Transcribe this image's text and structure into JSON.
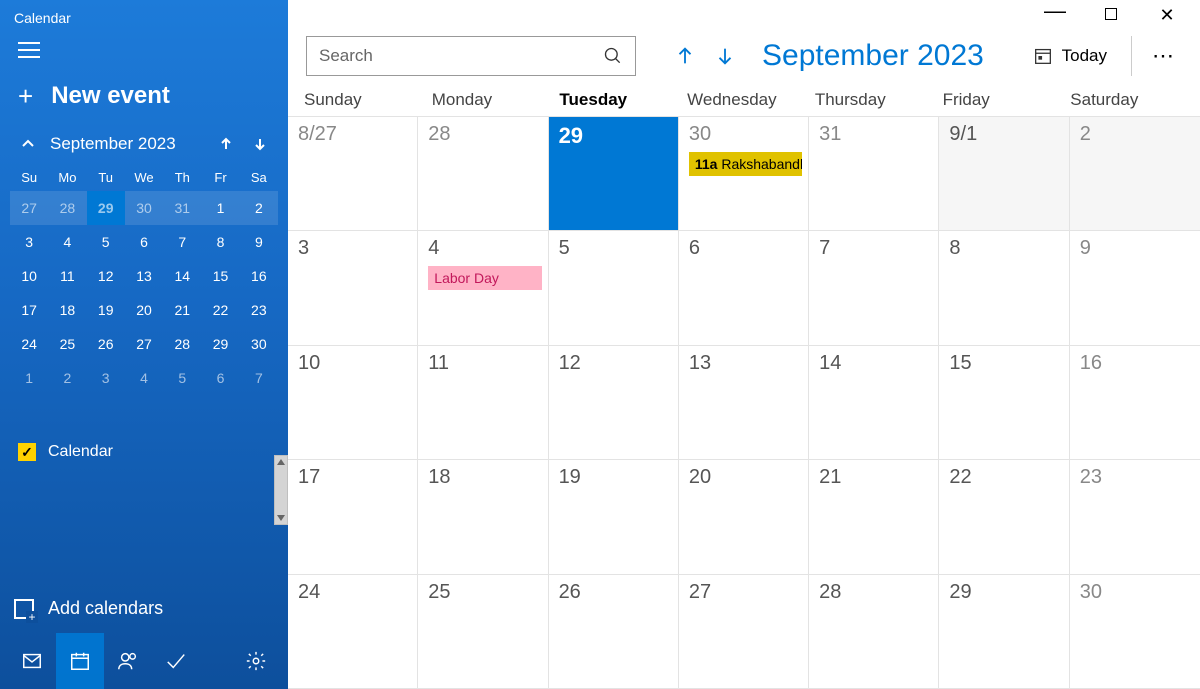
{
  "app": {
    "title": "Calendar"
  },
  "sidebar": {
    "new_event": "New event",
    "calendar_checkbox_label": "Calendar",
    "add_calendars": "Add calendars"
  },
  "mini_cal": {
    "month_label": "September 2023",
    "dow": [
      "Su",
      "Mo",
      "Tu",
      "We",
      "Th",
      "Fr",
      "Sa"
    ],
    "days": [
      {
        "n": "27",
        "out": true
      },
      {
        "n": "28",
        "out": true
      },
      {
        "n": "29",
        "sel": true,
        "out": true
      },
      {
        "n": "30",
        "out": true
      },
      {
        "n": "31",
        "out": true
      },
      {
        "n": "1"
      },
      {
        "n": "2"
      },
      {
        "n": "3"
      },
      {
        "n": "4"
      },
      {
        "n": "5"
      },
      {
        "n": "6"
      },
      {
        "n": "7"
      },
      {
        "n": "8"
      },
      {
        "n": "9"
      },
      {
        "n": "10"
      },
      {
        "n": "11"
      },
      {
        "n": "12"
      },
      {
        "n": "13"
      },
      {
        "n": "14"
      },
      {
        "n": "15"
      },
      {
        "n": "16"
      },
      {
        "n": "17"
      },
      {
        "n": "18"
      },
      {
        "n": "19"
      },
      {
        "n": "20"
      },
      {
        "n": "21"
      },
      {
        "n": "22"
      },
      {
        "n": "23"
      },
      {
        "n": "24"
      },
      {
        "n": "25"
      },
      {
        "n": "26"
      },
      {
        "n": "27"
      },
      {
        "n": "28"
      },
      {
        "n": "29"
      },
      {
        "n": "30"
      },
      {
        "n": "1",
        "out": true
      },
      {
        "n": "2",
        "out": true
      },
      {
        "n": "3",
        "out": true
      },
      {
        "n": "4",
        "out": true
      },
      {
        "n": "5",
        "out": true
      },
      {
        "n": "6",
        "out": true
      },
      {
        "n": "7",
        "out": true
      }
    ]
  },
  "toolbar": {
    "search_placeholder": "Search",
    "month_label": "September 2023",
    "today_label": "Today"
  },
  "dow_full": [
    "Sunday",
    "Monday",
    "Tuesday",
    "Wednesday",
    "Thursday",
    "Friday",
    "Saturday"
  ],
  "today_index": 2,
  "month_grid": [
    {
      "label": "8/27",
      "classes": "out"
    },
    {
      "label": "28",
      "classes": "out"
    },
    {
      "label": "29",
      "classes": "today"
    },
    {
      "label": "30",
      "classes": "out",
      "event": {
        "style": "yellow",
        "time": "11a",
        "title": "Rakshabandhan"
      }
    },
    {
      "label": "31",
      "classes": "out"
    },
    {
      "label": "9/1",
      "classes": "nmonth"
    },
    {
      "label": "2",
      "classes": "nmonth sat"
    },
    {
      "label": "3"
    },
    {
      "label": "4",
      "event": {
        "style": "pink",
        "title": "Labor Day"
      }
    },
    {
      "label": "5"
    },
    {
      "label": "6"
    },
    {
      "label": "7"
    },
    {
      "label": "8"
    },
    {
      "label": "9",
      "classes": "sat"
    },
    {
      "label": "10"
    },
    {
      "label": "11"
    },
    {
      "label": "12"
    },
    {
      "label": "13"
    },
    {
      "label": "14"
    },
    {
      "label": "15"
    },
    {
      "label": "16",
      "classes": "sat"
    },
    {
      "label": "17"
    },
    {
      "label": "18"
    },
    {
      "label": "19"
    },
    {
      "label": "20"
    },
    {
      "label": "21"
    },
    {
      "label": "22"
    },
    {
      "label": "23",
      "classes": "sat"
    },
    {
      "label": "24"
    },
    {
      "label": "25"
    },
    {
      "label": "26"
    },
    {
      "label": "27"
    },
    {
      "label": "28"
    },
    {
      "label": "29"
    },
    {
      "label": "30",
      "classes": "sat"
    }
  ]
}
